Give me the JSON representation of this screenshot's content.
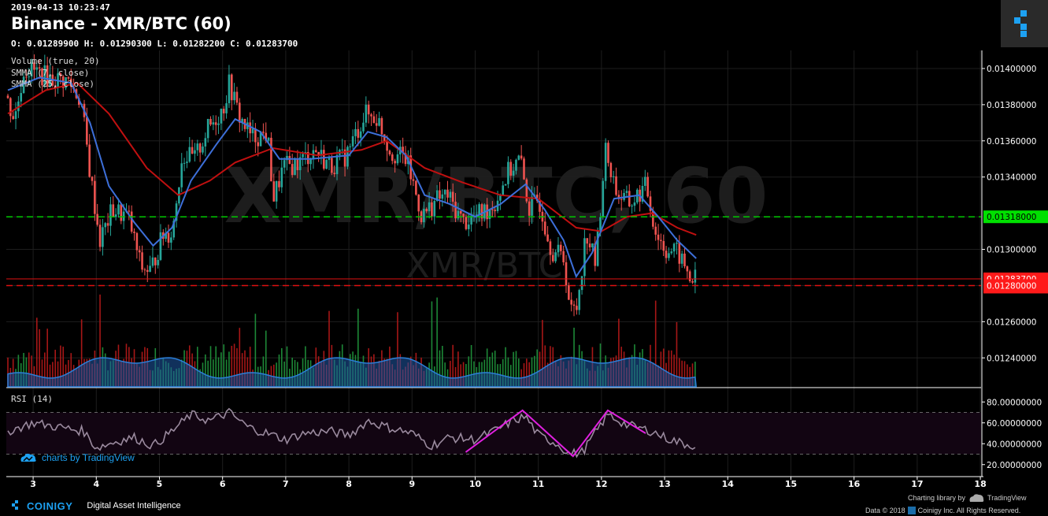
{
  "header": {
    "timestamp": "2019-04-13 10:23:47",
    "title": "Binance - XMR/BTC (60)",
    "ohlc": "O: 0.01289900 H: 0.01290300 L: 0.01282200 C: 0.01283700"
  },
  "indicators": [
    "Volume (true, 20)",
    "SMMA (7, close)",
    "SMMA (25, close)"
  ],
  "watermark": {
    "big": "XMR/BTC, 60",
    "small": "XMR/BTC"
  },
  "rsi_label": "RSI (14)",
  "footer": {
    "brand": "COINIGY",
    "tagline": "Digital Asset Intelligence",
    "tv_watermark": "charts by TradingView",
    "charting": "Charting library by",
    "tv_name": "TradingView",
    "copyright_pre": "Data © 2018",
    "copyright_post": "Coinigy Inc. All Rights Reserved."
  },
  "colors": {
    "up": "#26a69a",
    "down": "#ef5350",
    "smma7": "#3d6fd9",
    "smma25": "#c01010",
    "green_line": "#00c800",
    "red_line": "#e01010",
    "rsi": "#9a8a9e",
    "pattern": "#e020e0"
  },
  "chart_data": {
    "type": "candlestick",
    "price_axis": {
      "ticks": [
        "0.01400000",
        "0.01380000",
        "0.01360000",
        "0.01340000",
        "0.01300000",
        "0.01260000",
        "0.01240000"
      ],
      "ylim": [
        0.01224,
        0.0141
      ]
    },
    "time_axis": {
      "ticks": [
        "3",
        "4",
        "5",
        "6",
        "7",
        "8",
        "9",
        "10",
        "11",
        "12",
        "13",
        "14",
        "15",
        "16",
        "17",
        "18"
      ]
    },
    "rsi_axis": {
      "ticks": [
        "80.00000000",
        "60.00000000",
        "40.00000000",
        "20.00000000"
      ],
      "ylim": [
        10,
        90
      ],
      "band": [
        30,
        70
      ]
    },
    "horizontal_lines": [
      {
        "value": 0.01318,
        "label": "0.01318000",
        "color": "green"
      },
      {
        "value": 0.0128,
        "label": "0.01280000",
        "color": "red"
      }
    ],
    "last_price": {
      "value": 0.012837,
      "label": "0.01283700"
    },
    "price_path": [
      [
        2.6,
        0.01385
      ],
      [
        2.75,
        0.01372
      ],
      [
        2.9,
        0.014
      ],
      [
        3.1,
        0.01398
      ],
      [
        3.35,
        0.01394
      ],
      [
        3.6,
        0.01393
      ],
      [
        3.8,
        0.01382
      ],
      [
        3.95,
        0.0134
      ],
      [
        4.1,
        0.01305
      ],
      [
        4.3,
        0.01322
      ],
      [
        4.55,
        0.01318
      ],
      [
        4.75,
        0.0129
      ],
      [
        4.9,
        0.01288
      ],
      [
        5.1,
        0.01308
      ],
      [
        5.25,
        0.0131
      ],
      [
        5.4,
        0.01352
      ],
      [
        5.6,
        0.0135
      ],
      [
        5.8,
        0.01366
      ],
      [
        6.05,
        0.01378
      ],
      [
        6.15,
        0.01392
      ],
      [
        6.3,
        0.01374
      ],
      [
        6.5,
        0.01362
      ],
      [
        6.75,
        0.01364
      ],
      [
        6.85,
        0.01328
      ],
      [
        7.0,
        0.01345
      ],
      [
        7.25,
        0.01348
      ],
      [
        7.5,
        0.01355
      ],
      [
        7.75,
        0.01346
      ],
      [
        8.0,
        0.01352
      ],
      [
        8.3,
        0.01375
      ],
      [
        8.5,
        0.01372
      ],
      [
        8.7,
        0.01354
      ],
      [
        8.95,
        0.0135
      ],
      [
        9.2,
        0.01318
      ],
      [
        9.45,
        0.01328
      ],
      [
        9.6,
        0.0133
      ],
      [
        9.85,
        0.01315
      ],
      [
        10.15,
        0.0132
      ],
      [
        10.35,
        0.01325
      ],
      [
        10.55,
        0.01342
      ],
      [
        10.75,
        0.0135
      ],
      [
        10.9,
        0.01322
      ],
      [
        11.05,
        0.01328
      ],
      [
        11.25,
        0.013
      ],
      [
        11.45,
        0.01295
      ],
      [
        11.55,
        0.01265
      ],
      [
        11.65,
        0.01268
      ],
      [
        11.8,
        0.0131
      ],
      [
        11.95,
        0.01292
      ],
      [
        12.1,
        0.01355
      ],
      [
        12.3,
        0.0133
      ],
      [
        12.5,
        0.01325
      ],
      [
        12.75,
        0.01335
      ],
      [
        12.9,
        0.0131
      ],
      [
        13.05,
        0.013
      ],
      [
        13.25,
        0.01298
      ],
      [
        13.45,
        0.012837
      ]
    ],
    "smma7": [
      [
        2.6,
        0.01388
      ],
      [
        3.1,
        0.01395
      ],
      [
        3.6,
        0.01392
      ],
      [
        3.9,
        0.0137
      ],
      [
        4.2,
        0.01335
      ],
      [
        4.6,
        0.01315
      ],
      [
        4.9,
        0.01302
      ],
      [
        5.2,
        0.01312
      ],
      [
        5.5,
        0.01338
      ],
      [
        5.9,
        0.01358
      ],
      [
        6.2,
        0.01372
      ],
      [
        6.6,
        0.01365
      ],
      [
        6.9,
        0.0135
      ],
      [
        7.4,
        0.0135
      ],
      [
        8.0,
        0.01352
      ],
      [
        8.3,
        0.01365
      ],
      [
        8.6,
        0.01362
      ],
      [
        8.9,
        0.01352
      ],
      [
        9.2,
        0.0133
      ],
      [
        9.6,
        0.01325
      ],
      [
        10.0,
        0.01318
      ],
      [
        10.4,
        0.01325
      ],
      [
        10.8,
        0.01336
      ],
      [
        11.1,
        0.01322
      ],
      [
        11.4,
        0.01305
      ],
      [
        11.6,
        0.01285
      ],
      [
        11.85,
        0.01298
      ],
      [
        12.2,
        0.01328
      ],
      [
        12.6,
        0.0133
      ],
      [
        12.9,
        0.01318
      ],
      [
        13.2,
        0.01305
      ],
      [
        13.5,
        0.01295
      ]
    ],
    "smma25": [
      [
        2.6,
        0.01375
      ],
      [
        3.2,
        0.01388
      ],
      [
        3.7,
        0.01392
      ],
      [
        4.2,
        0.01375
      ],
      [
        4.8,
        0.01345
      ],
      [
        5.3,
        0.0133
      ],
      [
        5.8,
        0.01338
      ],
      [
        6.2,
        0.01348
      ],
      [
        6.8,
        0.01356
      ],
      [
        7.5,
        0.01352
      ],
      [
        8.2,
        0.01355
      ],
      [
        8.6,
        0.0136
      ],
      [
        9.2,
        0.01345
      ],
      [
        9.8,
        0.01337
      ],
      [
        10.4,
        0.0133
      ],
      [
        11.0,
        0.01328
      ],
      [
        11.6,
        0.01312
      ],
      [
        12.0,
        0.0131
      ],
      [
        12.4,
        0.01318
      ],
      [
        12.8,
        0.0132
      ],
      [
        13.2,
        0.01312
      ],
      [
        13.5,
        0.01308
      ]
    ],
    "rsi_path": [
      [
        2.6,
        52
      ],
      [
        3.0,
        60
      ],
      [
        3.4,
        56
      ],
      [
        3.8,
        52
      ],
      [
        4.0,
        36
      ],
      [
        4.3,
        42
      ],
      [
        4.6,
        46
      ],
      [
        4.9,
        38
      ],
      [
        5.2,
        52
      ],
      [
        5.5,
        68
      ],
      [
        5.8,
        62
      ],
      [
        6.1,
        70
      ],
      [
        6.4,
        56
      ],
      [
        6.8,
        48
      ],
      [
        7.0,
        44
      ],
      [
        7.3,
        50
      ],
      [
        7.7,
        52
      ],
      [
        8.0,
        48
      ],
      [
        8.3,
        62
      ],
      [
        8.6,
        56
      ],
      [
        9.0,
        50
      ],
      [
        9.3,
        38
      ],
      [
        9.6,
        46
      ],
      [
        10.0,
        44
      ],
      [
        10.3,
        52
      ],
      [
        10.6,
        62
      ],
      [
        10.8,
        66
      ],
      [
        11.0,
        48
      ],
      [
        11.3,
        40
      ],
      [
        11.5,
        30
      ],
      [
        11.7,
        32
      ],
      [
        11.9,
        50
      ],
      [
        12.1,
        68
      ],
      [
        12.4,
        58
      ],
      [
        12.8,
        52
      ],
      [
        13.0,
        46
      ],
      [
        13.3,
        40
      ],
      [
        13.5,
        38
      ]
    ],
    "rsi_pattern": [
      [
        9.85,
        32
      ],
      [
        10.75,
        72
      ],
      [
        11.55,
        28
      ],
      [
        12.1,
        72
      ],
      [
        12.7,
        50
      ]
    ],
    "volume_bars_note": "volume histogram with SMA",
    "volume_ylim": [
      0,
      100
    ]
  }
}
